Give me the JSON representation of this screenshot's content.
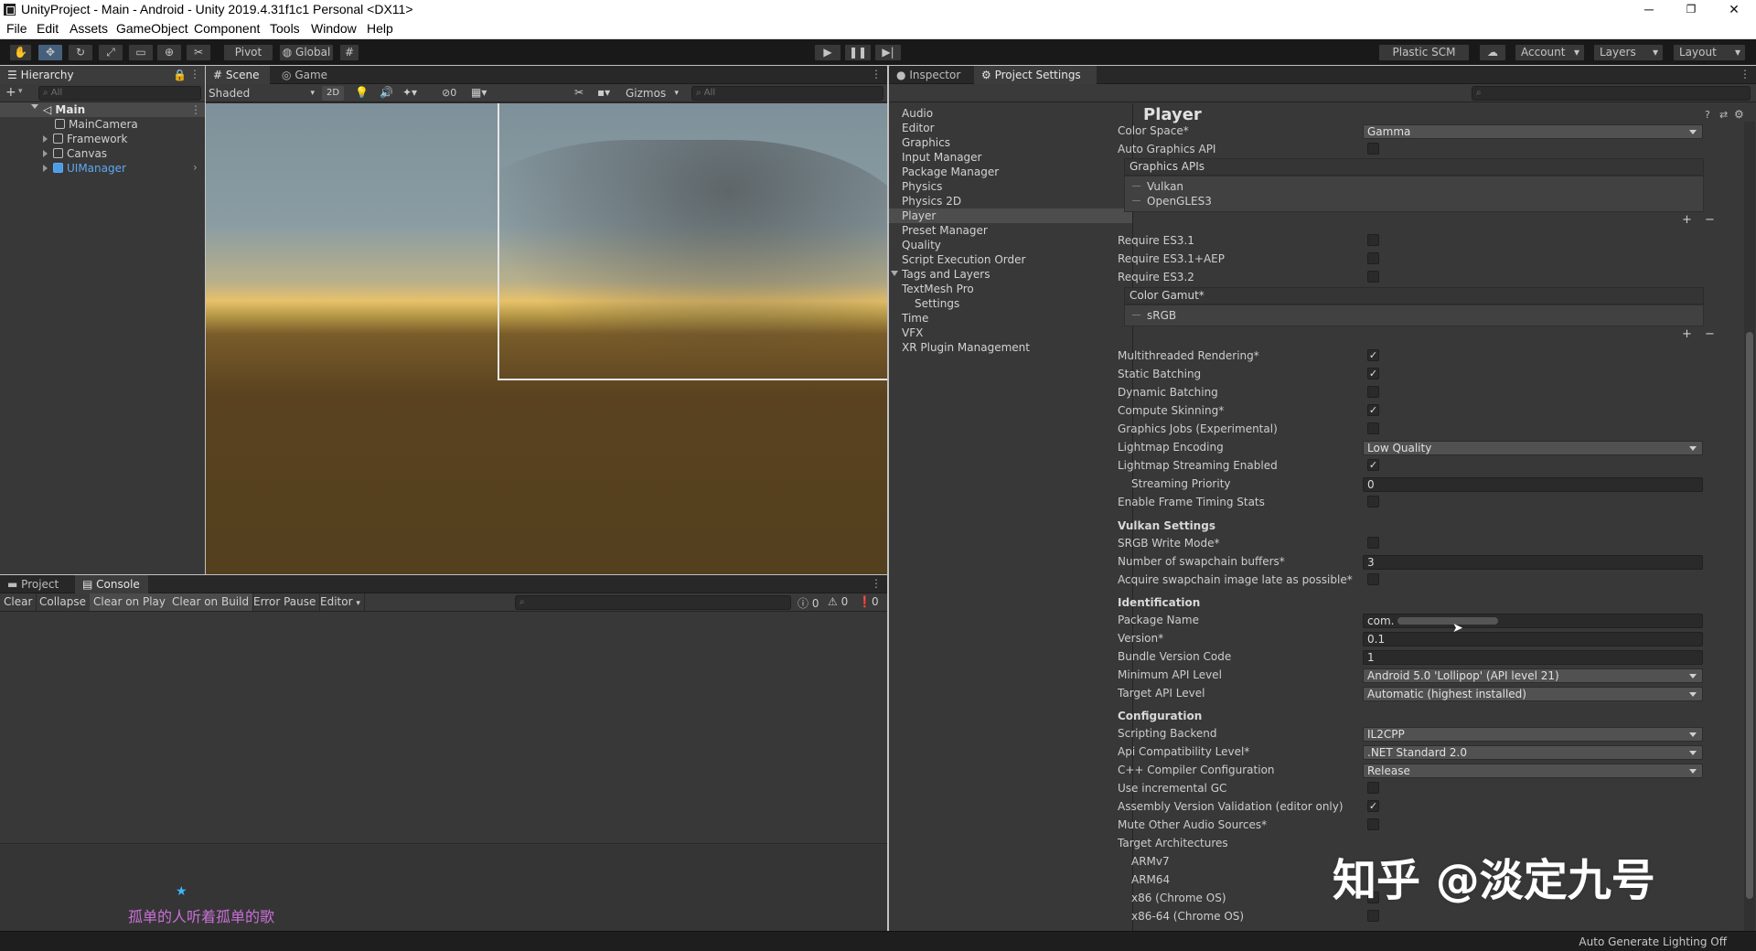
{
  "window": {
    "title": "UnityProject - Main - Android - Unity 2019.4.31f1c1 Personal <DX11>",
    "minimize": "─",
    "maximize": "❐",
    "close": "✕"
  },
  "menu": [
    "File",
    "Edit",
    "Assets",
    "GameObject",
    "Component",
    "Tools",
    "Window",
    "Help"
  ],
  "toolbar": {
    "pivot_label": "Pivot",
    "global_label": "Global",
    "plastic_label": "Plastic SCM",
    "account_label": "Account",
    "layers_label": "Layers",
    "layout_label": "Layout"
  },
  "hierarchy": {
    "tab": "Hierarchy",
    "add": "+",
    "search_placeholder": "All",
    "scene": "Main",
    "items": [
      "MainCamera",
      "Framework",
      "Canvas",
      "UIManager"
    ]
  },
  "scene_view": {
    "tab_scene": "Scene",
    "tab_game": "Game",
    "shading": "Shaded",
    "mode_2d": "2D",
    "hidden_count": "0",
    "gizmos": "Gizmos",
    "search_placeholder": "All"
  },
  "console": {
    "tab_project": "Project",
    "tab_console": "Console",
    "buttons": [
      "Clear",
      "Collapse",
      "Clear on Play",
      "Clear on Build",
      "Error Pause",
      "Editor"
    ],
    "counts": {
      "log": "0",
      "warning": "0",
      "error": "0"
    }
  },
  "inspector": {
    "tab_inspector": "Inspector",
    "tab_project_settings": "Project Settings",
    "categories": [
      "Audio",
      "Editor",
      "Graphics",
      "Input Manager",
      "Package Manager",
      "Physics",
      "Physics 2D",
      "Player",
      "Preset Manager",
      "Quality",
      "Script Execution Order",
      "Tags and Layers",
      "TextMesh Pro",
      "Settings",
      "Time",
      "VFX",
      "XR Plugin Management"
    ],
    "selected_category": "Player",
    "page_title": "Player",
    "color_space_label": "Color Space*",
    "color_space_value": "Gamma",
    "auto_graphics_api_label": "Auto Graphics API",
    "graphics_apis_label": "Graphics APIs",
    "graphics_apis": [
      "Vulkan",
      "OpenGLES3"
    ],
    "require_es31": "Require ES3.1",
    "require_es31_aep": "Require ES3.1+AEP",
    "require_es32": "Require ES3.2",
    "color_gamut_label": "Color Gamut*",
    "color_gamut_items": [
      "sRGB"
    ],
    "plus": "+",
    "minus": "−",
    "checks": [
      {
        "label": "Multithreaded Rendering*",
        "checked": true
      },
      {
        "label": "Static Batching",
        "checked": true
      },
      {
        "label": "Dynamic Batching",
        "checked": false
      },
      {
        "label": "Compute Skinning*",
        "checked": true
      },
      {
        "label": "Graphics Jobs (Experimental)",
        "checked": false
      }
    ],
    "lightmap_encoding_label": "Lightmap Encoding",
    "lightmap_encoding_value": "Low Quality",
    "lightmap_streaming_label": "Lightmap Streaming Enabled",
    "streaming_priority_label": "Streaming Priority",
    "streaming_priority_value": "0",
    "frame_timing_label": "Enable Frame Timing Stats",
    "vulkan_header": "Vulkan Settings",
    "srgb_write_label": "SRGB Write Mode*",
    "swapchain_label": "Number of swapchain buffers*",
    "swapchain_value": "3",
    "acquire_late_label": "Acquire swapchain image late as possible*",
    "identification_header": "Identification",
    "package_name_label": "Package Name",
    "package_name_value": "com.",
    "version_label": "Version*",
    "version_value": "0.1",
    "bundle_code_label": "Bundle Version Code",
    "bundle_code_value": "1",
    "min_api_label": "Minimum API Level",
    "min_api_value": "Android 5.0 'Lollipop' (API level 21)",
    "target_api_label": "Target API Level",
    "target_api_value": "Automatic (highest installed)",
    "configuration_header": "Configuration",
    "scripting_backend_label": "Scripting Backend",
    "scripting_backend_value": "IL2CPP",
    "api_compat_label": "Api Compatibility Level*",
    "api_compat_value": ".NET Standard 2.0",
    "cpp_config_label": "C++ Compiler Configuration",
    "cpp_config_value": "Release",
    "incremental_gc_label": "Use incremental GC",
    "assembly_validation_label": "Assembly Version Validation (editor only)",
    "mute_audio_label": "Mute Other Audio Sources*",
    "target_arch_label": "Target Architectures",
    "arch": [
      "ARMv7",
      "ARM64",
      "x86 (Chrome OS)",
      "x86-64 (Chrome OS)"
    ]
  },
  "status_bar": {
    "text": "Auto Generate Lighting Off"
  },
  "watermark": {
    "zhihu": "知乎 @淡定九号",
    "corner": "孤单的人听着孤单的歌"
  }
}
